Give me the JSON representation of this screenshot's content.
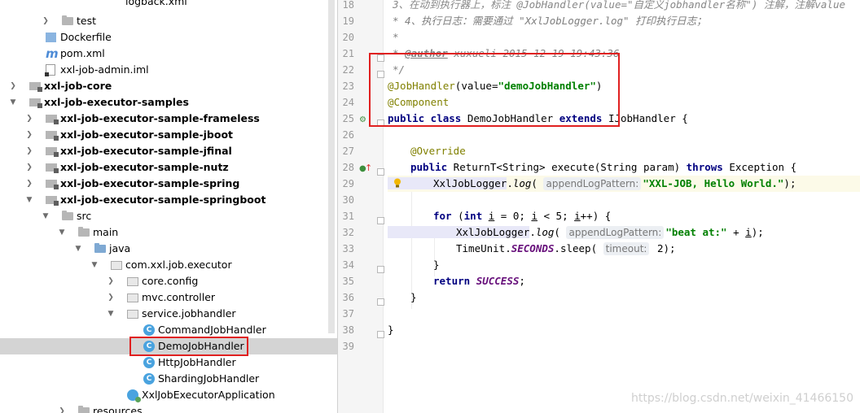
{
  "project_tree": {
    "items": [
      {
        "label": "logback.xml",
        "icon": "xml-file-icon",
        "expanded": null,
        "bold": false
      },
      {
        "label": "test",
        "icon": "folder-icon",
        "expanded": false,
        "bold": false
      },
      {
        "label": "Dockerfile",
        "icon": "docker-file-icon",
        "expanded": null,
        "bold": false
      },
      {
        "label": "pom.xml",
        "icon": "maven-icon",
        "expanded": null,
        "bold": false
      },
      {
        "label": "xxl-job-admin.iml",
        "icon": "iml-file-icon",
        "expanded": null,
        "bold": false
      },
      {
        "label": "xxl-job-core",
        "icon": "module-icon",
        "expanded": false,
        "bold": true
      },
      {
        "label": "xxl-job-executor-samples",
        "icon": "module-icon",
        "expanded": true,
        "bold": true
      },
      {
        "label": "xxl-job-executor-sample-frameless",
        "icon": "module-icon",
        "expanded": false,
        "bold": true
      },
      {
        "label": "xxl-job-executor-sample-jboot",
        "icon": "module-icon",
        "expanded": false,
        "bold": true
      },
      {
        "label": "xxl-job-executor-sample-jfinal",
        "icon": "module-icon",
        "expanded": false,
        "bold": true
      },
      {
        "label": "xxl-job-executor-sample-nutz",
        "icon": "module-icon",
        "expanded": false,
        "bold": true
      },
      {
        "label": "xxl-job-executor-sample-spring",
        "icon": "module-icon",
        "expanded": false,
        "bold": true
      },
      {
        "label": "xxl-job-executor-sample-springboot",
        "icon": "module-icon",
        "expanded": true,
        "bold": true
      },
      {
        "label": "src",
        "icon": "folder-icon",
        "expanded": true,
        "bold": false
      },
      {
        "label": "main",
        "icon": "folder-icon",
        "expanded": true,
        "bold": false
      },
      {
        "label": "java",
        "icon": "source-folder-icon",
        "expanded": true,
        "bold": false
      },
      {
        "label": "com.xxl.job.executor",
        "icon": "package-icon",
        "expanded": true,
        "bold": false
      },
      {
        "label": "core.config",
        "icon": "package-icon",
        "expanded": false,
        "bold": false
      },
      {
        "label": "mvc.controller",
        "icon": "package-icon",
        "expanded": false,
        "bold": false
      },
      {
        "label": "service.jobhandler",
        "icon": "package-icon",
        "expanded": true,
        "bold": false
      },
      {
        "label": "CommandJobHandler",
        "icon": "class-icon",
        "expanded": null,
        "bold": false
      },
      {
        "label": "DemoJobHandler",
        "icon": "class-icon",
        "expanded": null,
        "bold": false,
        "selected": true
      },
      {
        "label": "HttpJobHandler",
        "icon": "class-icon",
        "expanded": null,
        "bold": false
      },
      {
        "label": "ShardingJobHandler",
        "icon": "class-icon",
        "expanded": null,
        "bold": false
      },
      {
        "label": "XxlJobExecutorApplication",
        "icon": "spring-app-icon",
        "expanded": null,
        "bold": false
      },
      {
        "label": "resources",
        "icon": "folder-icon",
        "expanded": false,
        "bold": false
      }
    ]
  },
  "editor": {
    "line_numbers": [
      "18",
      "19",
      "20",
      "21",
      "22",
      "23",
      "24",
      "25",
      "26",
      "27",
      "28",
      "29",
      "30",
      "31",
      "32",
      "33",
      "34",
      "35",
      "36",
      "37",
      "38",
      "39"
    ],
    "line18_partial": "3、在动到执行器上，标注 @JobHandler(value=\"自定义jobhandler名称\") 注解，注解value",
    "line19": "* 4、执行日志：需要通过 \"XxlJobLogger.log\" 打印执行日志；",
    "line20": "*",
    "line21_tag": "@author",
    "line21_rest": " xuxueli 2015-12-19 19:43:36",
    "line22": "*/",
    "line23_ann": "@JobHandler",
    "line23_pre": "(value=",
    "line23_str": "\"demoJobHandler\"",
    "line23_post": ")",
    "line24_ann": "@Component",
    "line25_kw1": "public class",
    "line25_name": " DemoJobHandler ",
    "line25_kw2": "extends",
    "line25_parent": " IJobHandler {",
    "line27_ann": "@Override",
    "line28_kw": "public",
    "line28_mid": " ReturnT<String> execute(String param) ",
    "line28_kw2": "throws",
    "line28_post": " Exception {",
    "line29_cls": "XxlJobLogger",
    "line29_dot": ".",
    "line29_method": "log",
    "line29_open": "( ",
    "line29_hint": "appendLogPattern:",
    "line29_str": "\"XXL-JOB, Hello World.\"",
    "line29_close": ");",
    "line31_kw": "for",
    "line31_a": " (",
    "line31_int": "int",
    "line31_b": " ",
    "line31_i1": "i",
    "line31_c": " = 0; ",
    "line31_i2": "i",
    "line31_d": " < 5; ",
    "line31_i3": "i",
    "line31_e": "++) {",
    "line32_cls": "XxlJobLogger",
    "line32_dot": ".",
    "line32_method": "log",
    "line32_open": "( ",
    "line32_hint": "appendLogPattern:",
    "line32_str": "\"beat at:\"",
    "line32_plus": " + ",
    "line32_i": "i",
    "line32_close": ");",
    "line33_a": "TimeUnit.",
    "line33_static": "SECONDS",
    "line33_b": ".sleep( ",
    "line33_hint": "timeout:",
    "line33_c": " 2);",
    "line34": "}",
    "line35_kw": "return",
    "line35_static": "SUCCESS",
    "line35_end": ";",
    "line36": "}",
    "line38": "}"
  },
  "watermark": "https://blog.csdn.net/weixin_41466150",
  "colors": {
    "highlight_box": "#e02020",
    "selection": "#d4d4d4",
    "keyword": "#000080",
    "annotation": "#808000",
    "string": "#008000",
    "comment": "#808080"
  }
}
